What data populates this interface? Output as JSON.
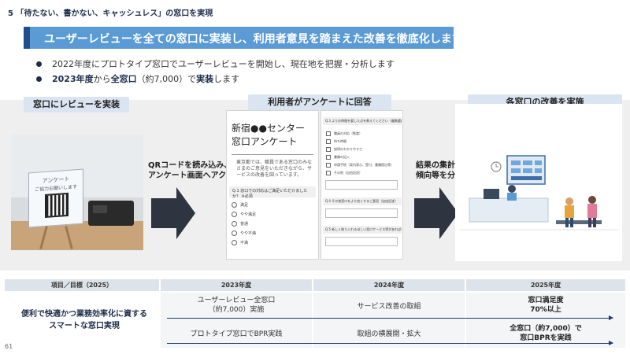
{
  "section_title": "5 「待たない、書かない、キャッシュレス」の窓口を実現",
  "banner": "ユーザーレビューを全ての窓口に実装し、利用者意見を踏まえた改善を徹底化します",
  "bullets": [
    {
      "text": "2022年度にプロトタイプ窓口でユーザーレビューを開始し、現在地を把握・分析します"
    },
    {
      "bold1": "2023年度",
      "mid": "から",
      "bold2": "全窓口",
      "paren": "（約7,000）で",
      "bold3": "実装",
      "tail": "します"
    }
  ],
  "steps": [
    {
      "label": "窓口にレビューを実装"
    },
    {
      "label": "利用者がアンケートに回答"
    },
    {
      "label": "各窓口の改善を実施"
    }
  ],
  "photo": {
    "card_title": "アンケート",
    "card_sub": "ご協力お願いします"
  },
  "arrow1": {
    "line1": "QRコードを読み込み、",
    "line2": "アンケート画面へアクセス"
  },
  "arrow2": {
    "line1": "結果の集計",
    "line2": "傾向等を分析"
  },
  "survey1": {
    "title_line1": "新宿●●センター",
    "title_line2": "窓口アンケート",
    "intro": "東京都では、職員である窓口のみなさまのご意見をいただきながら、サービスの改善を図っています。",
    "question": "Q.1 窓口での対応はご満足いただけましたか？ ※必須",
    "options": [
      "満足",
      "やや満足",
      "普通",
      "やや不満",
      "不満"
    ]
  },
  "survey2": {
    "q3": "Q.3 よりお時間を要した点を教えてください（複数選択可）",
    "checks": [
      "職員の対応（態度）",
      "待ち時間",
      "説明のわかりやすさ",
      "書類の記入",
      "申請手続（案内表示、受付、書類提出等）",
      "その他（自由記述）"
    ],
    "q4": "Q.4 その他窓口をより良くするご意見（自由記述）",
    "q5": "Q.5 新しく取り入れるほしい窓口サービス等があれば教えてください（自由記述）"
  },
  "table": {
    "headers": [
      "項目／目標（2025）",
      "2023年度",
      "2024年度",
      "2025年度"
    ],
    "goal_line1": "便利で快適かつ業務効率化に資する",
    "goal_line2": "スマートな窓口実現",
    "row1_2023_line1": "ユーザーレビュー全窓口",
    "row1_2023_line2": "（約7,000）実施",
    "row1_2024": "サービス改善の取組",
    "row1_2025_line1": "窓口満足度",
    "row1_2025_line2": "70%以上",
    "row2_2023": "プロトタイプ窓口でBPR実践",
    "row2_2024": "取組の横展開・拡大",
    "row2_2025_line1": "全窓口（約7,000）で",
    "row2_2025_line2": "窓口BPRを実践"
  },
  "page_number": "61",
  "colors": {
    "banner": "#5b9bd5",
    "banner_accent": "#1f4e8a",
    "navy": "#1f2d4a",
    "pill": "#dbe5f1",
    "arrow": "#2e3440"
  }
}
